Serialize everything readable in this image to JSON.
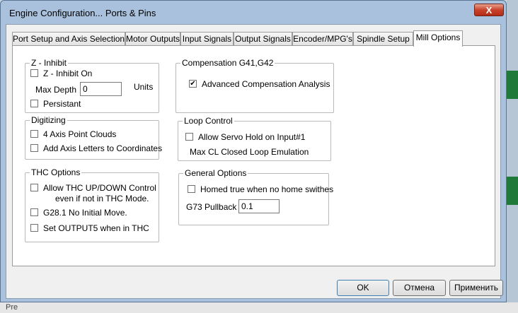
{
  "window": {
    "title": "Engine Configuration... Ports & Pins",
    "close_glyph": "X"
  },
  "tabs": [
    {
      "label": "Port Setup and Axis Selection",
      "active": false
    },
    {
      "label": "Motor Outputs",
      "active": false
    },
    {
      "label": "Input Signals",
      "active": false
    },
    {
      "label": "Output Signals",
      "active": false
    },
    {
      "label": "Encoder/MPG's",
      "active": false
    },
    {
      "label": "Spindle Setup",
      "active": false
    },
    {
      "label": "Mill Options",
      "active": true
    }
  ],
  "z_inhibit": {
    "title": "Z - Inhibit",
    "inhibit_on": {
      "label": "Z - Inhibit On",
      "checked": false
    },
    "max_depth_label": "Max Depth",
    "max_depth_value": "0",
    "units_label": "Units",
    "persistant": {
      "label": "Persistant",
      "checked": false
    }
  },
  "digitizing": {
    "title": "Digitizing",
    "four_axis": {
      "label": "4 Axis Point Clouds",
      "checked": false
    },
    "axis_letters": {
      "label": "Add Axis Letters to Coordinates",
      "checked": false
    }
  },
  "thc_options": {
    "title": "THC Options",
    "allow_updown": {
      "label": "Allow THC UP/DOWN Control",
      "label_line2": "even if not in THC Mode.",
      "checked": false
    },
    "g28": {
      "label": "G28.1 No Initial Move.",
      "checked": false
    },
    "output5": {
      "label": "Set OUTPUT5 when in THC",
      "checked": false
    }
  },
  "compensation": {
    "title": "Compensation G41,G42",
    "advanced": {
      "label": "Advanced Compensation Analysis",
      "checked": true,
      "glyph": "✔"
    }
  },
  "loop_control": {
    "title": "Loop Control",
    "servo_hold": {
      "label": "Allow Servo Hold on Input#1",
      "checked": false
    },
    "max_cl_label": "Max CL Closed Loop Emulation"
  },
  "general_options": {
    "title": "General Options",
    "homed_true": {
      "label": "Homed true when no home swithes",
      "checked": false
    },
    "g73_label": "G73 Pullback",
    "g73_value": "0.1"
  },
  "buttons": {
    "ok": "OK",
    "cancel": "Отмена",
    "apply": "Применить"
  },
  "background": {
    "bottom_text": "Pre"
  }
}
